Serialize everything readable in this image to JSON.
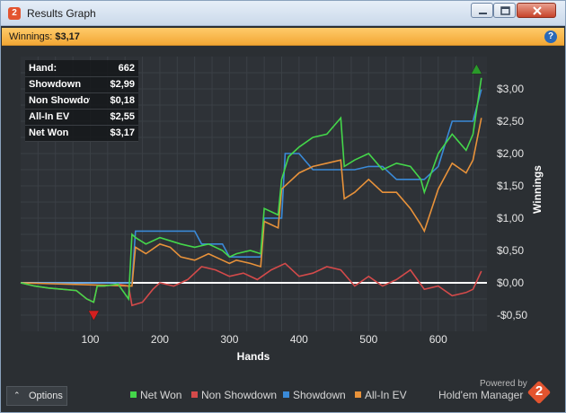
{
  "window": {
    "title": "Results Graph",
    "app_logo": "2"
  },
  "winbar": {
    "label": "Winnings:",
    "value": "$3,17",
    "help": "?"
  },
  "info": [
    {
      "label": "Hand:",
      "value": "662"
    },
    {
      "label": "Showdown",
      "value": "$2,99"
    },
    {
      "label": "Non Showdown",
      "value": "$0,18"
    },
    {
      "label": "All-In EV",
      "value": "$2,55"
    },
    {
      "label": "Net Won",
      "value": "$3,17"
    }
  ],
  "options": {
    "label": "Options"
  },
  "powered": {
    "line1": "Powered by",
    "line2": "Hold'em Manager",
    "logo": "2"
  },
  "colors": {
    "net_won": "#44d64a",
    "non_showdown": "#d44a4a",
    "showdown": "#3a8ad8",
    "allin_ev": "#e8923a",
    "background": "#2b2f33",
    "grid": "#3c4147"
  },
  "icons": [
    "app-logo-icon",
    "minimize-icon",
    "maximize-icon",
    "close-icon",
    "help-icon",
    "chevron-up-icon",
    "holdem-manager-logo-icon"
  ],
  "chart_data": {
    "type": "line",
    "xlabel": "Hands",
    "ylabel": "Winnings",
    "xlim": [
      0,
      670
    ],
    "ylim": [
      -0.75,
      3.5
    ],
    "x_ticks": [
      100,
      200,
      300,
      400,
      500,
      600
    ],
    "x_tick_labels": [
      "100",
      "200",
      "300",
      "400",
      "500",
      "600"
    ],
    "y_ticks": [
      -0.5,
      0,
      0.5,
      1,
      1.5,
      2,
      2.5,
      3
    ],
    "y_tick_labels": [
      "-$0,50",
      "$0,00",
      "$0,50",
      "$1,00",
      "$1,50",
      "$2,00",
      "$2,50",
      "$3,00"
    ],
    "grid": true,
    "legend_position": "bottom",
    "series": [
      {
        "name": "Net Won",
        "x": [
          0,
          20,
          40,
          60,
          80,
          95,
          105,
          110,
          120,
          140,
          155,
          160,
          165,
          180,
          200,
          215,
          230,
          250,
          270,
          290,
          300,
          310,
          330,
          345,
          350,
          370,
          375,
          385,
          400,
          420,
          440,
          460,
          465,
          480,
          500,
          520,
          540,
          560,
          575,
          580,
          600,
          620,
          640,
          650,
          662
        ],
        "y": [
          0,
          -0.05,
          -0.08,
          -0.1,
          -0.12,
          -0.25,
          -0.3,
          -0.05,
          -0.05,
          -0.02,
          -0.25,
          0.75,
          0.7,
          0.6,
          0.7,
          0.65,
          0.6,
          0.55,
          0.6,
          0.5,
          0.4,
          0.45,
          0.5,
          0.45,
          1.15,
          1.05,
          1.6,
          1.95,
          2.1,
          2.25,
          2.3,
          2.55,
          1.8,
          1.9,
          2.0,
          1.75,
          1.85,
          1.8,
          1.6,
          1.4,
          2.0,
          2.3,
          2.05,
          2.3,
          3.17
        ]
      },
      {
        "name": "Non Showdown",
        "x": [
          0,
          20,
          40,
          60,
          80,
          95,
          105,
          110,
          120,
          140,
          155,
          160,
          175,
          190,
          200,
          220,
          240,
          260,
          280,
          300,
          320,
          340,
          360,
          380,
          400,
          420,
          440,
          460,
          480,
          500,
          520,
          540,
          560,
          580,
          600,
          620,
          640,
          650,
          662
        ],
        "y": [
          0,
          -0.05,
          -0.08,
          -0.1,
          -0.12,
          -0.25,
          -0.3,
          -0.05,
          -0.05,
          -0.02,
          -0.05,
          -0.35,
          -0.3,
          -0.1,
          0.0,
          -0.05,
          0.05,
          0.25,
          0.2,
          0.1,
          0.15,
          0.05,
          0.2,
          0.3,
          0.1,
          0.15,
          0.25,
          0.2,
          -0.05,
          0.1,
          -0.05,
          0.05,
          0.2,
          -0.1,
          -0.05,
          -0.2,
          -0.15,
          -0.1,
          0.18
        ]
      },
      {
        "name": "Showdown",
        "x": [
          0,
          160,
          165,
          250,
          260,
          290,
          300,
          345,
          350,
          375,
          380,
          400,
          420,
          440,
          460,
          480,
          500,
          520,
          540,
          580,
          600,
          620,
          640,
          650,
          662
        ],
        "y": [
          0,
          0,
          0.8,
          0.8,
          0.6,
          0.6,
          0.4,
          0.4,
          1.0,
          1.0,
          2.0,
          2.0,
          1.75,
          1.75,
          1.75,
          1.75,
          1.8,
          1.8,
          1.6,
          1.6,
          1.8,
          2.5,
          2.5,
          2.5,
          2.99
        ]
      },
      {
        "name": "All-In EV",
        "x": [
          0,
          160,
          165,
          180,
          200,
          215,
          230,
          250,
          270,
          290,
          300,
          310,
          330,
          345,
          350,
          370,
          375,
          385,
          400,
          420,
          440,
          460,
          465,
          480,
          500,
          520,
          540,
          560,
          575,
          580,
          600,
          620,
          640,
          650,
          662
        ],
        "y": [
          0,
          -0.05,
          0.55,
          0.45,
          0.6,
          0.55,
          0.4,
          0.35,
          0.45,
          0.35,
          0.3,
          0.35,
          0.3,
          0.25,
          0.95,
          0.85,
          1.45,
          1.55,
          1.7,
          1.8,
          1.85,
          1.9,
          1.3,
          1.4,
          1.6,
          1.4,
          1.4,
          1.15,
          0.9,
          0.8,
          1.45,
          1.85,
          1.7,
          1.9,
          2.55
        ]
      }
    ],
    "markers": [
      {
        "type": "max",
        "x": 655,
        "y": 3.3,
        "color": "#2a9a2a"
      },
      {
        "type": "min",
        "x": 105,
        "y": -0.5,
        "color": "#d42020"
      }
    ]
  }
}
